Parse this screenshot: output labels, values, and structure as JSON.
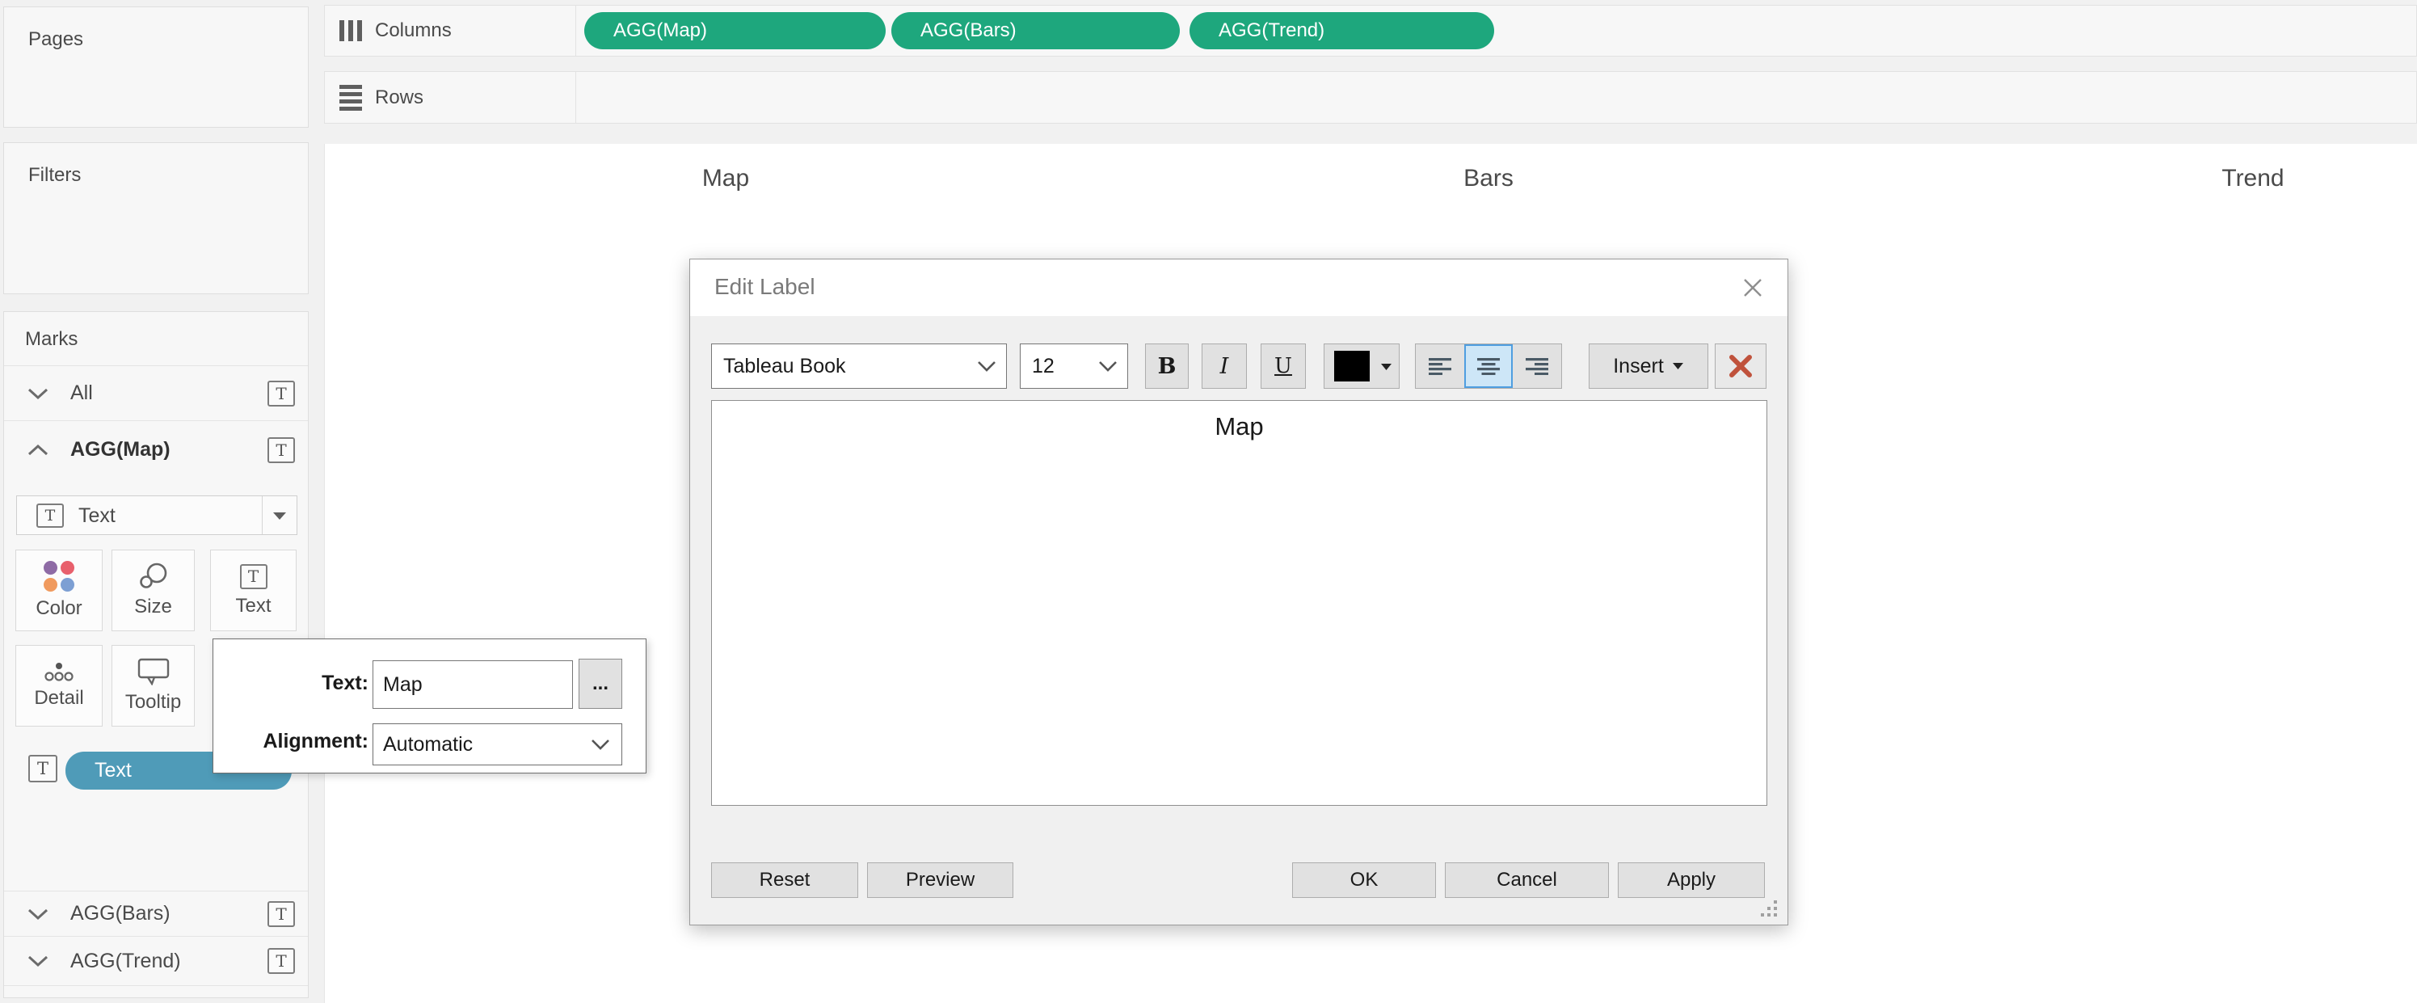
{
  "sidebar": {
    "pages_label": "Pages",
    "filters_label": "Filters",
    "marks_label": "Marks",
    "rows": [
      {
        "label": "All"
      },
      {
        "label": "AGG(Map)"
      },
      {
        "label": "AGG(Bars)"
      },
      {
        "label": "AGG(Trend)"
      }
    ],
    "mark_type_value": "Text",
    "mark_buttons": {
      "color": "Color",
      "size": "Size",
      "text": "Text",
      "detail": "Detail",
      "tooltip": "Tooltip"
    },
    "text_pill_label": "Text"
  },
  "shelves": {
    "columns_label": "Columns",
    "rows_label": "Rows",
    "pills": [
      {
        "label": "AGG(Map)"
      },
      {
        "label": "AGG(Bars)"
      },
      {
        "label": "AGG(Trend)"
      }
    ]
  },
  "canvas": {
    "headers": [
      {
        "label": "Map"
      },
      {
        "label": "Bars"
      },
      {
        "label": "Trend"
      }
    ]
  },
  "label_popover": {
    "text_label": "Text:",
    "text_value": "Map",
    "browse_label": "...",
    "alignment_label": "Alignment:",
    "alignment_value": "Automatic"
  },
  "dialog": {
    "title": "Edit Label",
    "toolbar": {
      "font_name": "Tableau Book",
      "font_size": "12",
      "bold": "B",
      "italic": "I",
      "underline": "U",
      "insert_label": "Insert"
    },
    "content": "Map",
    "footer": {
      "reset": "Reset",
      "preview": "Preview",
      "ok": "OK",
      "cancel": "Cancel",
      "apply": "Apply"
    }
  },
  "icons": {
    "t_glyph": "T"
  },
  "colors": {
    "pill_green": "#1ea77d",
    "pill_teal": "#4f9bb8",
    "align_selected_bg": "#cde6f7",
    "align_selected_border": "#4f9ee0",
    "red_x": "#c0523c",
    "color_dots": [
      "#8e6ba5",
      "#e8606c",
      "#f09a5e",
      "#7d9fd3"
    ]
  }
}
